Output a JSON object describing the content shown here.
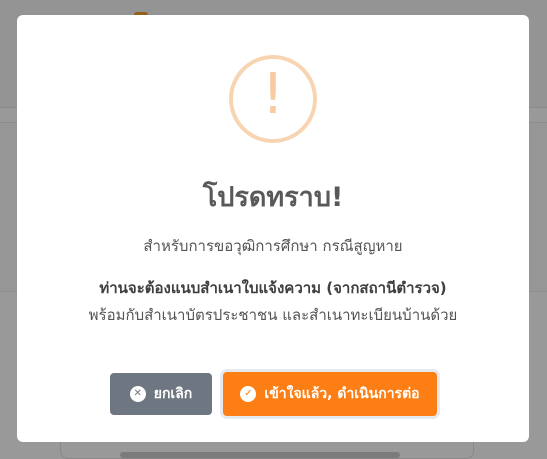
{
  "modal": {
    "title": "โปรดทราบ!",
    "line1": "สำหรับการขอวุฒิการศึกษา กรณีสูญหาย",
    "line2": "ท่านจะต้องแนบสำเนาใบแจ้งความ (จากสถานีตำรวจ)",
    "line3": "พร้อมกับสำเนาบัตรประชาชน และสำเนาทะเบียนบ้านด้วย",
    "warning_glyph": "!",
    "warning_icon": "exclamation-circle-icon",
    "buttons": {
      "cancel_label": "ยกเลิก",
      "cancel_icon": "times-circle-icon",
      "cancel_icon_glyph": "✕",
      "confirm_label": "เข้าใจแล้ว, ดำเนินการต่อ",
      "confirm_icon": "check-circle-icon",
      "confirm_icon_glyph": "✓"
    }
  },
  "colors": {
    "overlay": "rgba(0,0,0,0.40)",
    "warning_ring": "#f8d5b2",
    "confirm_bg": "#fd7e14",
    "cancel_bg": "#6e7781",
    "title_text": "#595959"
  }
}
